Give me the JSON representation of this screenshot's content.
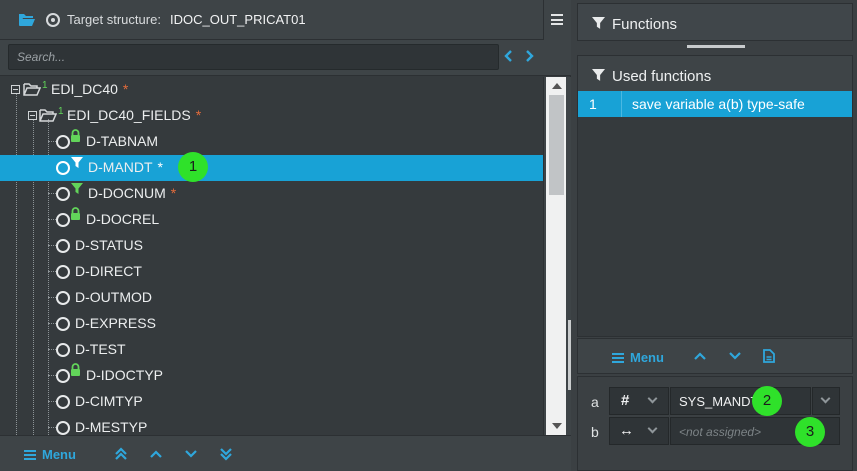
{
  "header": {
    "target_label": "Target structure:",
    "target_value": "IDOC_OUT_PRICAT01"
  },
  "search": {
    "placeholder": "Search..."
  },
  "tree": {
    "root": {
      "label": "EDI_DC40",
      "marker": "*",
      "sup": "1"
    },
    "group": {
      "label": "EDI_DC40_FIELDS",
      "marker": "*",
      "sup": "1"
    },
    "fields": [
      {
        "label": "D-TABNAM",
        "marker": "",
        "icon": "lock-icon"
      },
      {
        "label": "D-MANDT",
        "marker": "*",
        "icon": "filter-icon",
        "selected": true
      },
      {
        "label": "D-DOCNUM",
        "marker": "*",
        "icon": "filter-icon"
      },
      {
        "label": "D-DOCREL",
        "marker": "",
        "icon": "lock-icon"
      },
      {
        "label": "D-STATUS",
        "marker": ""
      },
      {
        "label": "D-DIRECT",
        "marker": ""
      },
      {
        "label": "D-OUTMOD",
        "marker": ""
      },
      {
        "label": "D-EXPRESS",
        "marker": ""
      },
      {
        "label": "D-TEST",
        "marker": ""
      },
      {
        "label": "D-IDOCTYP",
        "marker": "",
        "icon": "lock-icon"
      },
      {
        "label": "D-CIMTYP",
        "marker": ""
      },
      {
        "label": "D-MESTYP",
        "marker": ""
      }
    ]
  },
  "left_toolbar": {
    "menu_label": "Menu"
  },
  "right": {
    "functions_title": "Functions",
    "used_title": "Used functions",
    "used_functions": [
      {
        "num": "1",
        "name": "save variable a(b) type-safe"
      }
    ],
    "toolbar_menu_label": "Menu",
    "params": [
      {
        "name": "a",
        "type_symbol": "#",
        "value": "SYS_MANDT"
      },
      {
        "name": "b",
        "type_symbol": "↔",
        "placeholder": "<not assigned>"
      }
    ]
  },
  "annotations": [
    "1",
    "2",
    "3"
  ],
  "colors": {
    "selection": "#18a2d6",
    "accent_blue": "#2fa7dc",
    "marker_orange": "#e36b3b",
    "icon_green": "#62d45a",
    "badge_green": "#2fe12a"
  }
}
